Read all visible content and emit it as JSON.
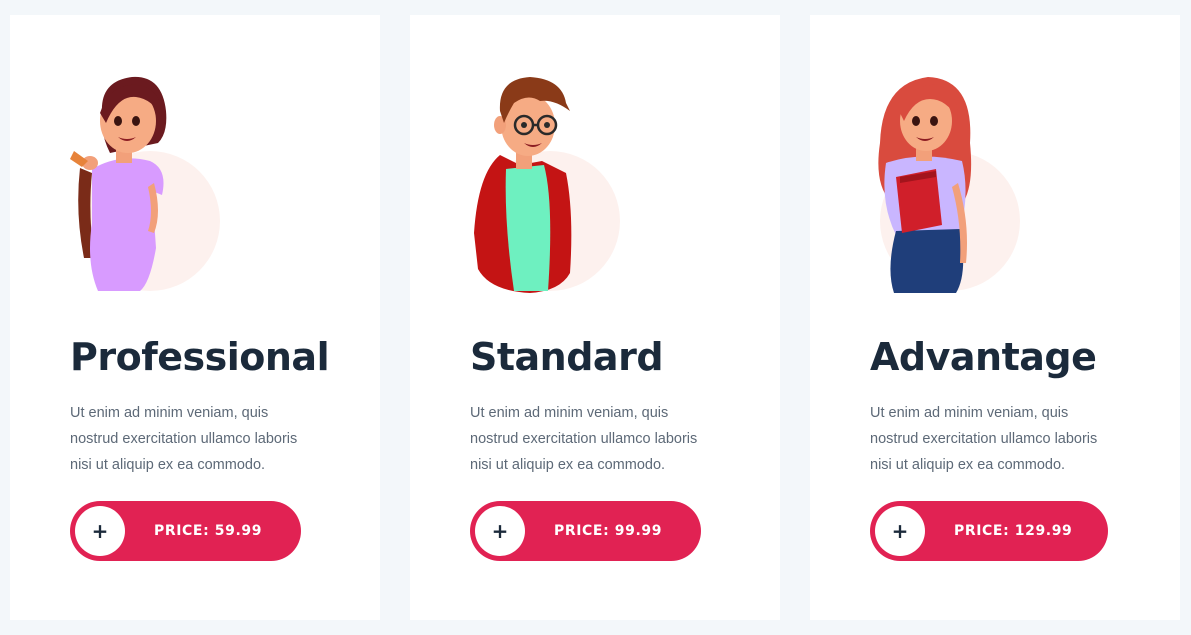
{
  "colors": {
    "page_background": "#f3f7fa",
    "card_background": "#ffffff",
    "accent": "#e12253",
    "title": "#1b2a3b",
    "body_text": "#5d6977"
  },
  "plans": [
    {
      "title": "Professional",
      "description": "Ut enim ad minim veniam, quis nostrud exercitation ullamco laboris nisi ut aliquip ex ea commodo.",
      "price_label": "PRICE: 59.99",
      "button_icon": "+",
      "illustration": "woman-with-backpack-illustration"
    },
    {
      "title": "Standard",
      "description": "Ut enim ad minim veniam, quis nostrud exercitation ullamco laboris nisi ut aliquip ex ea commodo.",
      "price_label": "PRICE: 99.99",
      "button_icon": "+",
      "illustration": "man-with-glasses-illustration"
    },
    {
      "title": "Advantage",
      "description": "Ut enim ad minim veniam, quis nostrud exercitation ullamco laboris nisi ut aliquip ex ea commodo.",
      "price_label": "PRICE: 129.99",
      "button_icon": "+",
      "illustration": "woman-with-book-illustration"
    }
  ]
}
